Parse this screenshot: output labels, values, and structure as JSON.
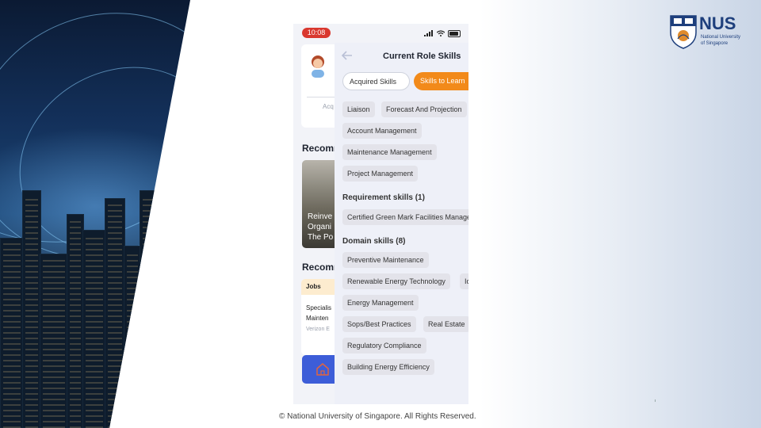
{
  "status_bar": {
    "time": "10:08"
  },
  "background_page": {
    "acquired_label": "Acq",
    "recommended_title_1": "Recomm",
    "recommended_card_text": "Reinve\nOrgani\nThe Po",
    "recommended_title_2": "Recomm",
    "jobs_tag": "Jobs",
    "job_title": "Specialis\nMainten",
    "job_company": "Verizon E"
  },
  "sheet": {
    "title": "Current Role Skills",
    "tabs": [
      {
        "label": "Acquired Skills",
        "selected": false
      },
      {
        "label": "Skills to Learn",
        "selected": true
      }
    ],
    "top_chips": [
      "Liaison",
      "Forecast And Projection",
      "Account Management",
      "Maintenance Management",
      "Project Management"
    ],
    "requirement_title": "Requirement skills (1)",
    "requirement_chips": [
      "Certified Green Mark Facilities Manager"
    ],
    "domain_title": "Domain skills (8)",
    "domain_chips": [
      "Preventive Maintenance",
      "Renewable Energy Technology",
      "Io",
      "Energy Management",
      "Sops/Best Practices",
      "Real Estate",
      "Regulatory Compliance",
      "Building Energy Efficiency"
    ]
  },
  "logo": {
    "wordmark": "NUS",
    "subtitle": "National University\nof Singapore"
  },
  "footer": {
    "copyright": "©  National University of Singapore. All Rights Reserved."
  },
  "colors": {
    "accent_orange": "#f28a1a",
    "time_pill_red": "#d9382f",
    "nus_blue": "#1e3f7c",
    "home_button_blue": "#3d5dd8"
  }
}
